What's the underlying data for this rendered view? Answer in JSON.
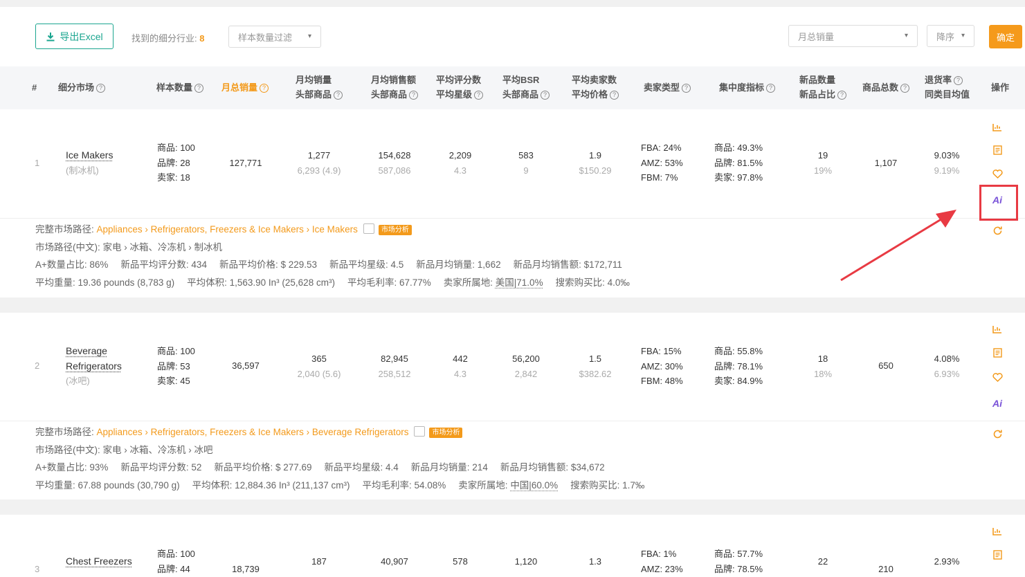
{
  "toolbar": {
    "export_label": "导出Excel",
    "found_label": "找到的细分行业:",
    "found_count": "8",
    "sample_filter_placeholder": "样本数量过滤",
    "sort_field": "月总销量",
    "sort_order": "降序",
    "confirm_label": "确定"
  },
  "columns": [
    {
      "l1": "#",
      "l2": ""
    },
    {
      "l1": "细分市场",
      "l2": ""
    },
    {
      "l1": "样本数量",
      "l2": ""
    },
    {
      "l1": "月总销量",
      "l2": ""
    },
    {
      "l1": "月均销量",
      "l2": "头部商品"
    },
    {
      "l1": "月均销售额",
      "l2": "头部商品"
    },
    {
      "l1": "平均评分数",
      "l2": "平均星级"
    },
    {
      "l1": "平均BSR",
      "l2": "头部商品"
    },
    {
      "l1": "平均卖家数",
      "l2": "平均价格"
    },
    {
      "l1": "卖家类型",
      "l2": ""
    },
    {
      "l1": "集中度指标",
      "l2": ""
    },
    {
      "l1": "新品数量",
      "l2": "新品占比"
    },
    {
      "l1": "商品总数",
      "l2": ""
    },
    {
      "l1": "退货率",
      "l2": "同类目均值"
    },
    {
      "l1": "操作",
      "l2": ""
    }
  ],
  "question_mark": "?",
  "rows": [
    {
      "index": "1",
      "name": "Ice Makers",
      "name_cn": "(制冰机)",
      "sample_products": "商品: 100",
      "sample_brands": "品牌: 28",
      "sample_sellers": "卖家: 18",
      "monthly_sales": "127,771",
      "avg_sales": "1,277",
      "avg_sales_top": "6,293 (4.9)",
      "avg_revenue": "154,628",
      "avg_revenue_top": "587,086",
      "avg_reviews": "2,209",
      "avg_rating": "4.3",
      "avg_bsr": "583",
      "avg_bsr_top": "9",
      "avg_sellers": "1.9",
      "avg_price": "$150.29",
      "fba": "FBA: 24%",
      "amz": "AMZ: 53%",
      "fbm": "FBM: 7%",
      "conc_products": "商品: 49.3%",
      "conc_brands": "品牌: 81.5%",
      "conc_sellers": "卖家: 97.8%",
      "new_count": "19",
      "new_ratio": "19%",
      "total": "1,107",
      "return_rate": "9.03%",
      "return_avg": "9.19%",
      "path_label": "完整市场路径:",
      "path_1": "Appliances",
      "path_2": "Refrigerators, Freezers & Ice Makers",
      "path_3": "Ice Makers",
      "analysis_tag": "市场分析",
      "path_cn_label": "市场路径(中文):",
      "path_cn": "家电 › 冰箱、冷冻机 › 制冰机",
      "aplus": "A+数量占比: 86%",
      "new_reviews": "新品平均评分数: 434",
      "new_price": "新品平均价格: $ 229.53",
      "new_rating": "新品平均星级: 4.5",
      "new_sales": "新品月均销量: 1,662",
      "new_revenue": "新品月均销售额: $172,711",
      "weight": "平均重量: 19.36 pounds (8,783 g)",
      "volume": "平均体积: 1,563.90 In³ (25,628 cm³)",
      "margin": "平均毛利率: 67.77%",
      "seller_loc_label": "卖家所属地:",
      "seller_loc": "美国|71.0%",
      "search_ratio": "搜索购买比: 4.0‰"
    },
    {
      "index": "2",
      "name_1": "Beverage",
      "name_2": "Refrigerators",
      "name_cn": "(冰吧)",
      "sample_products": "商品: 100",
      "sample_brands": "品牌: 53",
      "sample_sellers": "卖家: 45",
      "monthly_sales": "36,597",
      "avg_sales": "365",
      "avg_sales_top": "2,040 (5.6)",
      "avg_revenue": "82,945",
      "avg_revenue_top": "258,512",
      "avg_reviews": "442",
      "avg_rating": "4.3",
      "avg_bsr": "56,200",
      "avg_bsr_top": "2,842",
      "avg_sellers": "1.5",
      "avg_price": "$382.62",
      "fba": "FBA: 15%",
      "amz": "AMZ: 30%",
      "fbm": "FBM: 48%",
      "conc_products": "商品: 55.8%",
      "conc_brands": "品牌: 78.1%",
      "conc_sellers": "卖家: 84.9%",
      "new_count": "18",
      "new_ratio": "18%",
      "total": "650",
      "return_rate": "4.08%",
      "return_avg": "6.93%",
      "path_label": "完整市场路径:",
      "path_1": "Appliances",
      "path_2": "Refrigerators, Freezers & Ice Makers",
      "path_3": "Beverage Refrigerators",
      "analysis_tag": "市场分析",
      "path_cn_label": "市场路径(中文):",
      "path_cn": "家电 › 冰箱、冷冻机 › 冰吧",
      "aplus": "A+数量占比: 93%",
      "new_reviews": "新品平均评分数: 52",
      "new_price": "新品平均价格: $ 277.69",
      "new_rating": "新品平均星级: 4.4",
      "new_sales": "新品月均销量: 214",
      "new_revenue": "新品月均销售额: $34,672",
      "weight": "平均重量: 67.88 pounds (30,790 g)",
      "volume": "平均体积: 12,884.36 In³ (211,137 cm³)",
      "margin": "平均毛利率: 54.08%",
      "seller_loc_label": "卖家所属地:",
      "seller_loc": "中国|60.0%",
      "search_ratio": "搜索购买比: 1.7‰"
    },
    {
      "index": "3",
      "name": "Chest Freezers",
      "sample_products": "商品: 100",
      "sample_brands": "品牌: 44",
      "monthly_sales": "18,739",
      "avg_sales": "187",
      "avg_revenue": "40,907",
      "avg_reviews": "578",
      "avg_bsr": "1,120",
      "avg_sellers": "1.3",
      "fba": "FBA: 1%",
      "amz": "AMZ: 23%",
      "conc_products": "商品: 57.7%",
      "conc_brands": "品牌: 78.5%",
      "new_count": "22",
      "total": "210",
      "return_rate": "2.93%"
    }
  ],
  "ops": {
    "ai_label": "Ai"
  },
  "colors": {
    "accent": "#f39a1b",
    "teal": "#1aa58f",
    "ai": "#7a53d8",
    "highlight": "#e83a43"
  }
}
